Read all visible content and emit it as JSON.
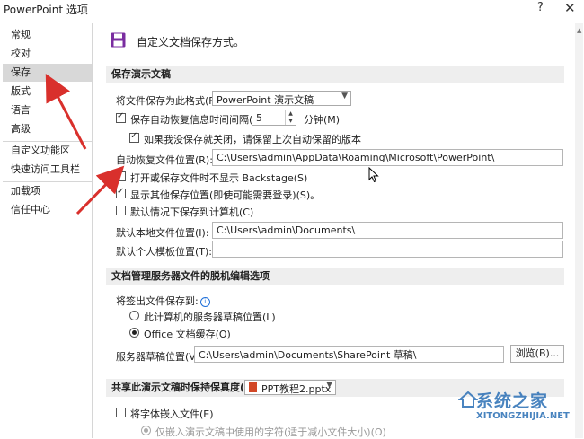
{
  "window": {
    "title": "PowerPoint 选项",
    "help": "?",
    "close": "✕"
  },
  "sidebar": {
    "items": [
      {
        "label": "常规",
        "active": false
      },
      {
        "label": "校对",
        "active": false
      },
      {
        "label": "保存",
        "active": true
      },
      {
        "label": "版式",
        "active": false
      },
      {
        "label": "语言",
        "active": false
      },
      {
        "label": "高级",
        "active": false
      },
      {
        "label": "自定义功能区",
        "active": false
      },
      {
        "label": "快速访问工具栏",
        "active": false
      },
      {
        "label": "加载项",
        "active": false
      },
      {
        "label": "信任中心",
        "active": false
      }
    ]
  },
  "main": {
    "heading": "自定义文档保存方式。",
    "save_section": {
      "title": "保存演示文稿",
      "format_label": "将文件保存为此格式(F):",
      "format_value": "PowerPoint 演示文稿",
      "autorecover_label": "保存自动恢复信息时间间隔(A)",
      "autorecover_checked": true,
      "autorecover_minutes": "5",
      "minutes_label": "分钟(M)",
      "keep_last_label": "如果我没保存就关闭，请保留上次自动保留的版本",
      "keep_last_checked": true,
      "autorecover_path_label": "自动恢复文件位置(R):",
      "autorecover_path": "C:\\Users\\admin\\AppData\\Roaming\\Microsoft\\PowerPoint\\",
      "no_backstage_label": "打开或保存文件时不显示 Backstage(S)",
      "no_backstage_checked": true,
      "show_other_label": "显示其他保存位置(即使可能需要登录)(S)。",
      "show_other_checked": true,
      "default_computer_label": "默认情况下保存到计算机(C)",
      "default_computer_checked": false,
      "local_path_label": "默认本地文件位置(I):",
      "local_path": "C:\\Users\\admin\\Documents\\",
      "template_label": "默认个人模板位置(T):",
      "template_path": ""
    },
    "offline_section": {
      "title": "文档管理服务器文件的脱机编辑选项",
      "checkout_label": "将签出文件保存到:",
      "info": "i",
      "option_server": "此计算机的服务器草稿位置(L)",
      "option_cache": "Office 文档缓存(O)",
      "selected": "cache",
      "drafts_label": "服务器草稿位置(V):",
      "drafts_path": "C:\\Users\\admin\\Documents\\SharePoint 草稿\\",
      "browse_label": "浏览(B)..."
    },
    "fidelity_section": {
      "title": "共享此演示文稿时保持保真度(D):",
      "file_value": "PPT教程2.pptx",
      "embed_fonts_label": "将字体嵌入文件(E)",
      "embed_fonts_checked": false,
      "embed_used_label": "仅嵌入演示文稿中使用的字符(适于减小文件大小)(O)"
    }
  },
  "watermark": {
    "title": "系统之家",
    "url": "XITONGZHIJIA.NET"
  },
  "colors": {
    "arrow": "#d9302c",
    "active_nav": "#d8d8d8",
    "section_bg": "#eeeeee",
    "watermark": "#2a6fb5"
  }
}
